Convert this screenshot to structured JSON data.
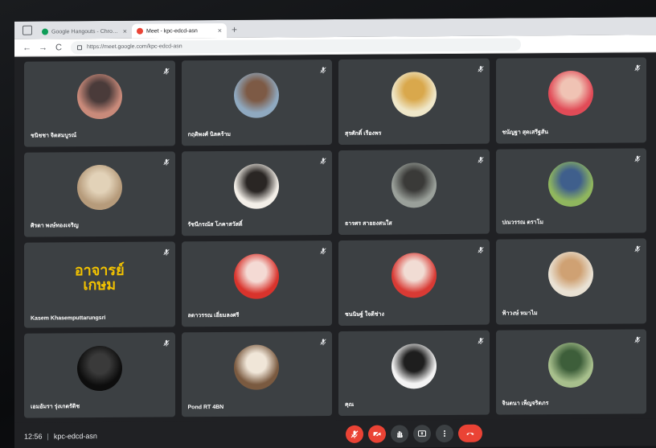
{
  "browser": {
    "tabs": [
      {
        "label": "Google Hangouts - Chrome We...",
        "active": false,
        "favicon_color": "#0f9d58"
      },
      {
        "label": "Meet - kpc-edcd-asn",
        "active": true,
        "favicon_color": "#ea4335"
      }
    ],
    "new_tab": "+",
    "back": "←",
    "forward": "→",
    "reload": "C",
    "url": "https://meet.google.com/kpc-edcd-asn"
  },
  "participants": [
    {
      "name": "ชนิชชา จิตสมบูรณ์",
      "avatar_colors": [
        "#c98a7a",
        "#4a3b3a"
      ]
    },
    {
      "name": "กฤติพงศ์ นิลคร้าม",
      "avatar_colors": [
        "#8fa9c0",
        "#7d5a45"
      ]
    },
    {
      "name": "สุรศักดิ์ เรืองพร",
      "avatar_colors": [
        "#efe7c9",
        "#d9a84c"
      ]
    },
    {
      "name": "ชนัญฐา สุดเสรีฐสัน",
      "avatar_colors": [
        "#e14b57",
        "#f0c3b4"
      ]
    },
    {
      "name": "ศิรดา พงษ์ทองเจริญ",
      "avatar_colors": [
        "#b69b7b",
        "#e2d2b8"
      ]
    },
    {
      "name": "รัชนีกรณัส โภคาสวัสดิ์",
      "avatar_colors": [
        "#f3efe8",
        "#2a2624"
      ]
    },
    {
      "name": "ธารศร สายยงสนใส",
      "avatar_colors": [
        "#9aa09a",
        "#3a3a38"
      ]
    },
    {
      "name": "ปณวรรณ ตราโม",
      "avatar_colors": [
        "#8fb65e",
        "#3f5f8c"
      ]
    },
    {
      "name": "Kasem Khasemputtarungsri",
      "avatar_colors": [
        "#2b2b26",
        "#2b2b26"
      ],
      "brand": "อาจารย์\nเกษม"
    },
    {
      "name": "ลดาวรรณ เอี่ยมลงศรี",
      "avatar_colors": [
        "#d9332c",
        "#f4dad4"
      ]
    },
    {
      "name": "ชนนิษฐ์ ใจดีช่าง",
      "avatar_colors": [
        "#d93a34",
        "#f1dcd4"
      ]
    },
    {
      "name": "ฟ้าวงษ์ หมาไม",
      "avatar_colors": [
        "#e9e1d3",
        "#cfa173"
      ]
    },
    {
      "name": "เอมอัมรา รุ่งเกตรัติช",
      "avatar_colors": [
        "#0d0d0d",
        "#3a3a3a"
      ]
    },
    {
      "name": "Pond RT 4BN",
      "avatar_colors": [
        "#7a5a40",
        "#f0e6d8"
      ]
    },
    {
      "name": "คุณ",
      "avatar_colors": [
        "#f3f3f3",
        "#1e1e1e"
      ]
    },
    {
      "name": "จินตนา เพ็ญจริตภร",
      "avatar_colors": [
        "#a7bf8c",
        "#3d5e3a"
      ]
    }
  ],
  "meeting": {
    "time": "12:56",
    "separator": "|",
    "code": "kpc-edcd-asn"
  },
  "controls": [
    {
      "name": "mic-off",
      "state": "off"
    },
    {
      "name": "camera-off",
      "state": "off"
    },
    {
      "name": "raise-hand",
      "state": "normal"
    },
    {
      "name": "present",
      "state": "normal"
    },
    {
      "name": "more-options",
      "state": "normal"
    },
    {
      "name": "leave-call",
      "state": "hangup"
    }
  ],
  "colors": {
    "stage_bg": "#202124",
    "tile_bg": "#3c4043",
    "danger": "#ea4335"
  }
}
